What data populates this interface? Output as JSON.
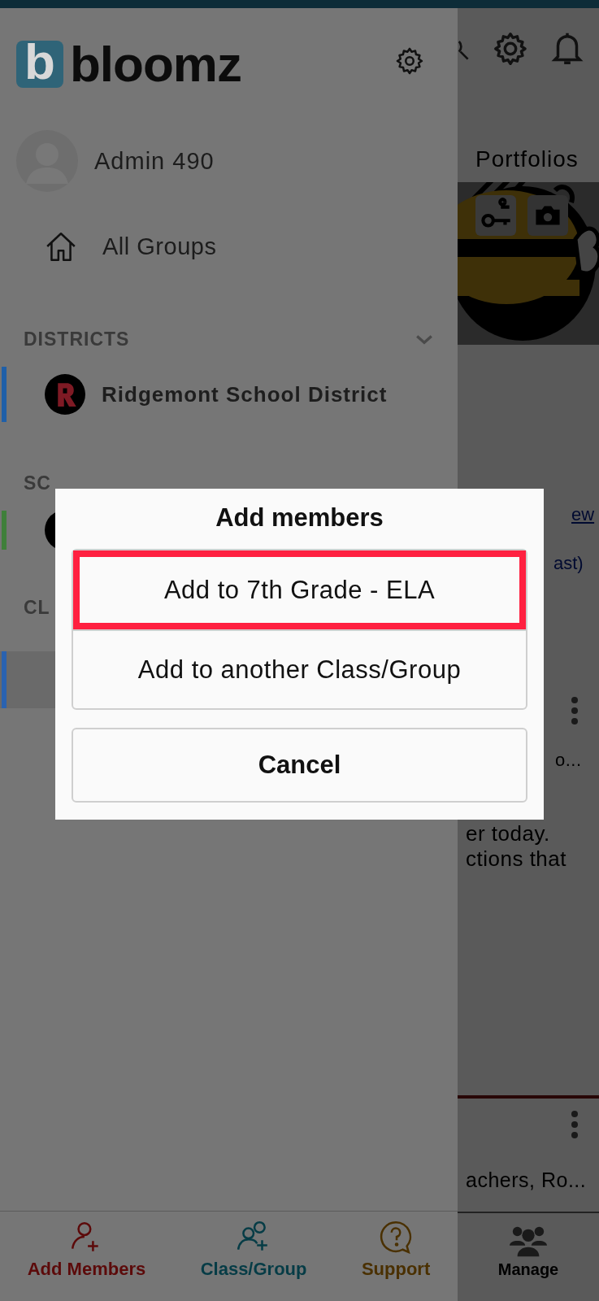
{
  "drawer": {
    "logo_letter": "b",
    "brand": "bloomz",
    "user": {
      "name": "Admin 490"
    },
    "all_groups": "All Groups",
    "sections": [
      {
        "title": "DISTRICTS",
        "items": [
          {
            "name": "Ridgemont School District",
            "color": "#1f5fa8"
          }
        ]
      },
      {
        "title": "SC",
        "items": [
          {
            "color": "#3f7f3a"
          }
        ]
      },
      {
        "title": "CL",
        "items": [
          {
            "color": "#2a62b0"
          }
        ]
      }
    ]
  },
  "background": {
    "tab": "Portfolios",
    "link_fragment": "ew",
    "link_fragment_2": "ast)",
    "post_1_lines": [
      "o...",
      "er today.",
      "ctions that"
    ],
    "post_2_line": "achers, Ro...",
    "manage_label": "Manage"
  },
  "dialog": {
    "title": "Add members",
    "options": [
      {
        "label": "Add to 7th Grade - ELA",
        "highlighted": true
      },
      {
        "label": "Add to another Class/Group",
        "highlighted": false
      }
    ],
    "cancel": "Cancel"
  },
  "bottom_nav": [
    {
      "label": "Add Members",
      "kind": "add-member",
      "color": "#5c0a0a"
    },
    {
      "label": "Class/Group",
      "kind": "add-group",
      "color": "#063c46"
    },
    {
      "label": "Support",
      "kind": "support",
      "color": "#4a3000"
    }
  ]
}
